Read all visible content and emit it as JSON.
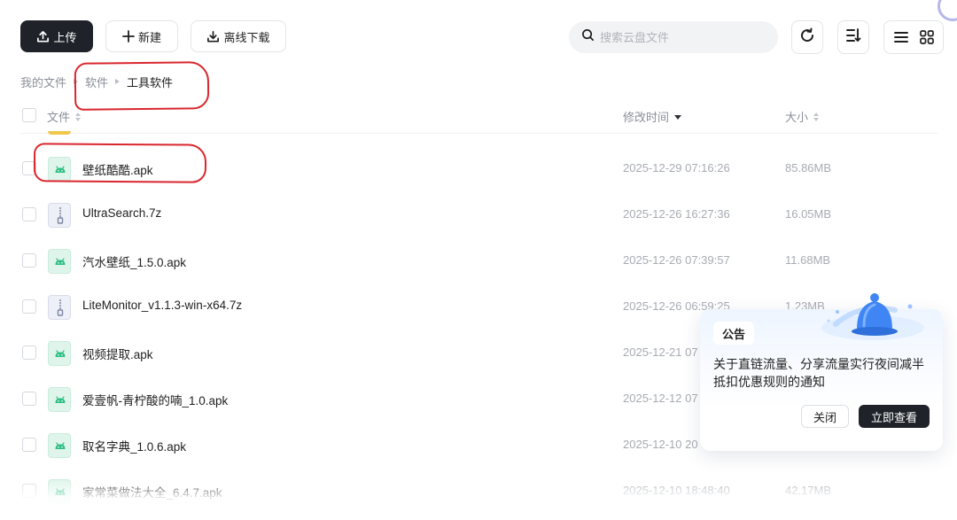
{
  "toolbar": {
    "upload_label": "上传",
    "new_label": "新建",
    "offline_download_label": "离线下载"
  },
  "search": {
    "placeholder": "搜索云盘文件"
  },
  "breadcrumb": {
    "items": [
      "我的文件",
      "软件",
      "工具软件"
    ]
  },
  "table": {
    "headers": {
      "name": "文件",
      "modified": "修改时间",
      "size": "大小"
    },
    "sort": {
      "column": "修改时间",
      "order": "descending"
    },
    "rows": [
      {
        "name": "壁纸酷酷.apk",
        "modified": "2025-12-29 07:16:26",
        "size": "85.86MB",
        "icon": "android-apk-icon"
      },
      {
        "name": "UltraSearch.7z",
        "modified": "2025-12-26 16:27:36",
        "size": "16.05MB",
        "icon": "archive-zip-icon"
      },
      {
        "name": "汽水壁纸_1.5.0.apk",
        "modified": "2025-12-26 07:39:57",
        "size": "11.68MB",
        "icon": "android-apk-icon"
      },
      {
        "name": "LiteMonitor_v1.1.3-win-x64.7z",
        "modified": "2025-12-26 06:59:25",
        "size": "1.23MB",
        "icon": "archive-zip-icon"
      },
      {
        "name": "视频提取.apk",
        "modified": "2025-12-21 07",
        "size": "",
        "icon": "android-apk-icon"
      },
      {
        "name": "爱壹帆-青柠酸的喃_1.0.apk",
        "modified": "2025-12-12 07",
        "size": "",
        "icon": "android-apk-icon"
      },
      {
        "name": "取名字典_1.0.6.apk",
        "modified": "2025-12-10 20",
        "size": "",
        "icon": "android-apk-icon"
      },
      {
        "name": "家常菜做法大全_6.4.7.apk",
        "modified": "2025-12-10 18:48:40",
        "size": "42.17MB",
        "icon": "android-apk-icon"
      }
    ]
  },
  "notice": {
    "tag": "公告",
    "text": "关于直链流量、分享流量实行夜间减半抵扣优惠规则的通知",
    "close_label": "关闭",
    "view_label": "立即查看"
  },
  "colors": {
    "primary_dark": "#1f2329",
    "annotation_red": "#d9262e",
    "apk_green": "#2fbf83",
    "muted_text": "#a7abb2"
  }
}
